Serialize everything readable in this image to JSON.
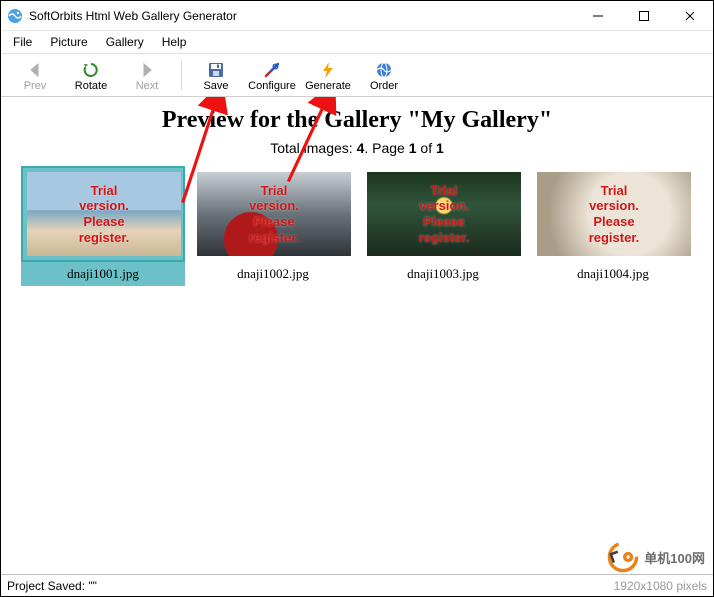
{
  "window": {
    "title": "SoftOrbits Html Web Gallery Generator"
  },
  "menu": {
    "file": "File",
    "picture": "Picture",
    "gallery": "Gallery",
    "help": "Help"
  },
  "toolbar": {
    "prev": "Prev",
    "rotate": "Rotate",
    "next": "Next",
    "save": "Save",
    "configure": "Configure",
    "generate": "Generate",
    "order": "Order"
  },
  "preview": {
    "title": "Preview for the Gallery \"My Gallery\"",
    "infoPrefix": "Total images: ",
    "totalImages": "4",
    "infoMiddle": ". Page ",
    "pageCurrent": "1",
    "infoOf": " of ",
    "pageTotal": "1"
  },
  "watermark": "Trial\nversion.\nPlease\nregister.",
  "thumbs": [
    {
      "filename": "dnaji1001.jpg",
      "selected": true,
      "bg": "bg1"
    },
    {
      "filename": "dnaji1002.jpg",
      "selected": false,
      "bg": "bg2"
    },
    {
      "filename": "dnaji1003.jpg",
      "selected": false,
      "bg": "bg3"
    },
    {
      "filename": "dnaji1004.jpg",
      "selected": false,
      "bg": "bg4"
    }
  ],
  "status": {
    "left": "Project Saved: \"\"",
    "right": "1920x1080 pixels"
  },
  "siteWatermark": {
    "text": "单机100网"
  }
}
